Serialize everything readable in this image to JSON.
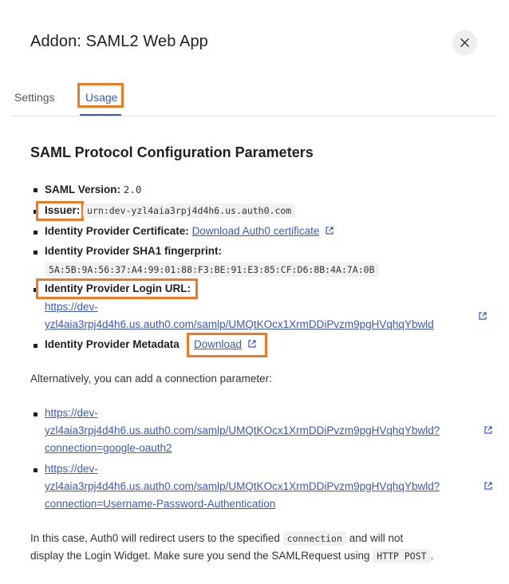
{
  "modal": {
    "title": "Addon: SAML2 Web App",
    "close_label": "close"
  },
  "tabs": [
    {
      "label": "Settings"
    },
    {
      "label": "Usage"
    }
  ],
  "section": {
    "title": "SAML Protocol Configuration Parameters"
  },
  "params": {
    "saml_version_label": "SAML Version:",
    "saml_version_value": "2.0",
    "issuer_label": "Issuer:",
    "issuer_value": "urn:dev-yzl4aia3rpj4d4h6.us.auth0.com",
    "certificate_label": "Identity Provider Certificate:",
    "certificate_link": "Download Auth0 certificate",
    "fingerprint_label": "Identity Provider SHA1 fingerprint:",
    "fingerprint_value": "5A:5B:9A:56:37:A4:99:01:88:F3:BE:91:E3:85:CF:D6:8B:4A:7A:0B",
    "login_url_label": "Identity Provider Login URL:",
    "login_url_line1": "https://dev-",
    "login_url_line2": "yzl4aia3rpj4d4h6.us.auth0.com/samlp/UMQtKOcx1XrmDDiPvzm9pgHVqhqYbwld",
    "metadata_label": "Identity Provider Metadata",
    "metadata_link": "Download"
  },
  "alternative": {
    "intro": "Alternatively, you can add a connection parameter:",
    "links": [
      {
        "line1": "https://dev-",
        "line2": "yzl4aia3rpj4d4h6.us.auth0.com/samlp/UMQtKOcx1XrmDDiPvzm9pgHVqhqYbwld?",
        "line3": "connection=google-oauth2"
      },
      {
        "line1": "https://dev-",
        "line2": "yzl4aia3rpj4d4h6.us.auth0.com/samlp/UMQtKOcx1XrmDDiPvzm9pgHVqhqYbwld?",
        "line3": "connection=Username-Password-Authentication"
      }
    ]
  },
  "footer_note": {
    "part1": "In this case, Auth0 will redirect users to the specified",
    "code1": "connection",
    "part2": "and will not",
    "part3": "display the Login Widget. Make sure you send the SAMLRequest using",
    "code2": "HTTP POST",
    "part4": "."
  },
  "colors": {
    "accent": "#3a57c4",
    "highlight": "#f07a24"
  }
}
